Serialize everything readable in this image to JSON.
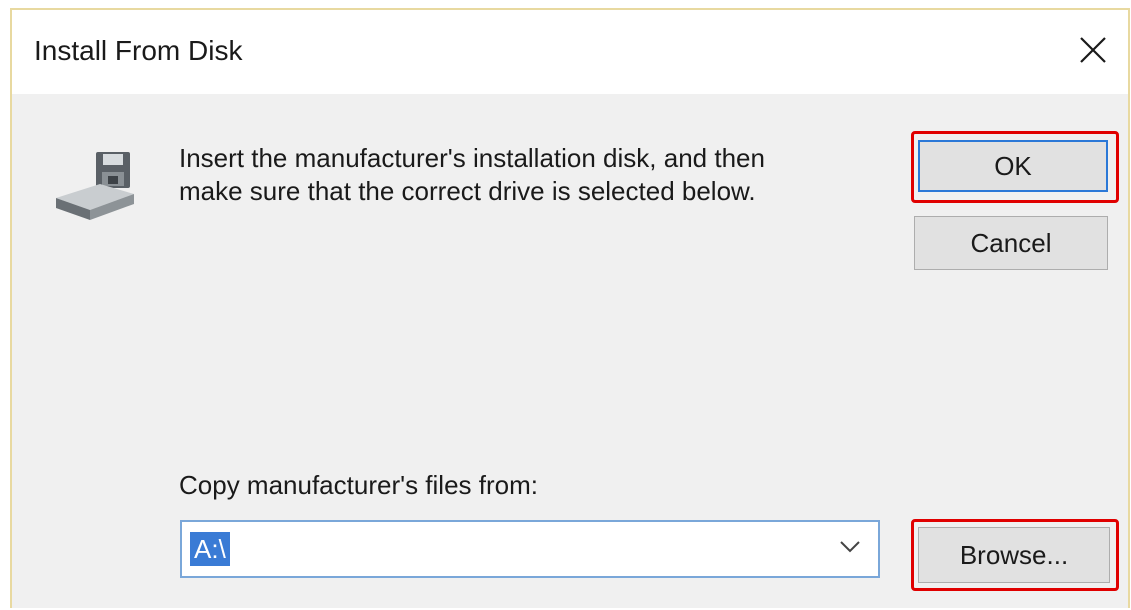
{
  "window": {
    "title": "Install From Disk",
    "close_icon": "close-icon"
  },
  "message": {
    "line1": "Insert the manufacturer's installation disk, and then",
    "line2": "make sure that the correct drive is selected below.",
    "icon": "disk-drive-icon"
  },
  "buttons": {
    "ok_label": "OK",
    "cancel_label": "Cancel",
    "browse_label": "Browse..."
  },
  "copy_from": {
    "label": "Copy manufacturer's files from:",
    "value": "A:\\",
    "dropdown_icon": "chevron-down-icon"
  },
  "colors": {
    "highlight": "#e00000",
    "selection": "#3a7bd5",
    "default_button_border": "#2b78d7"
  }
}
